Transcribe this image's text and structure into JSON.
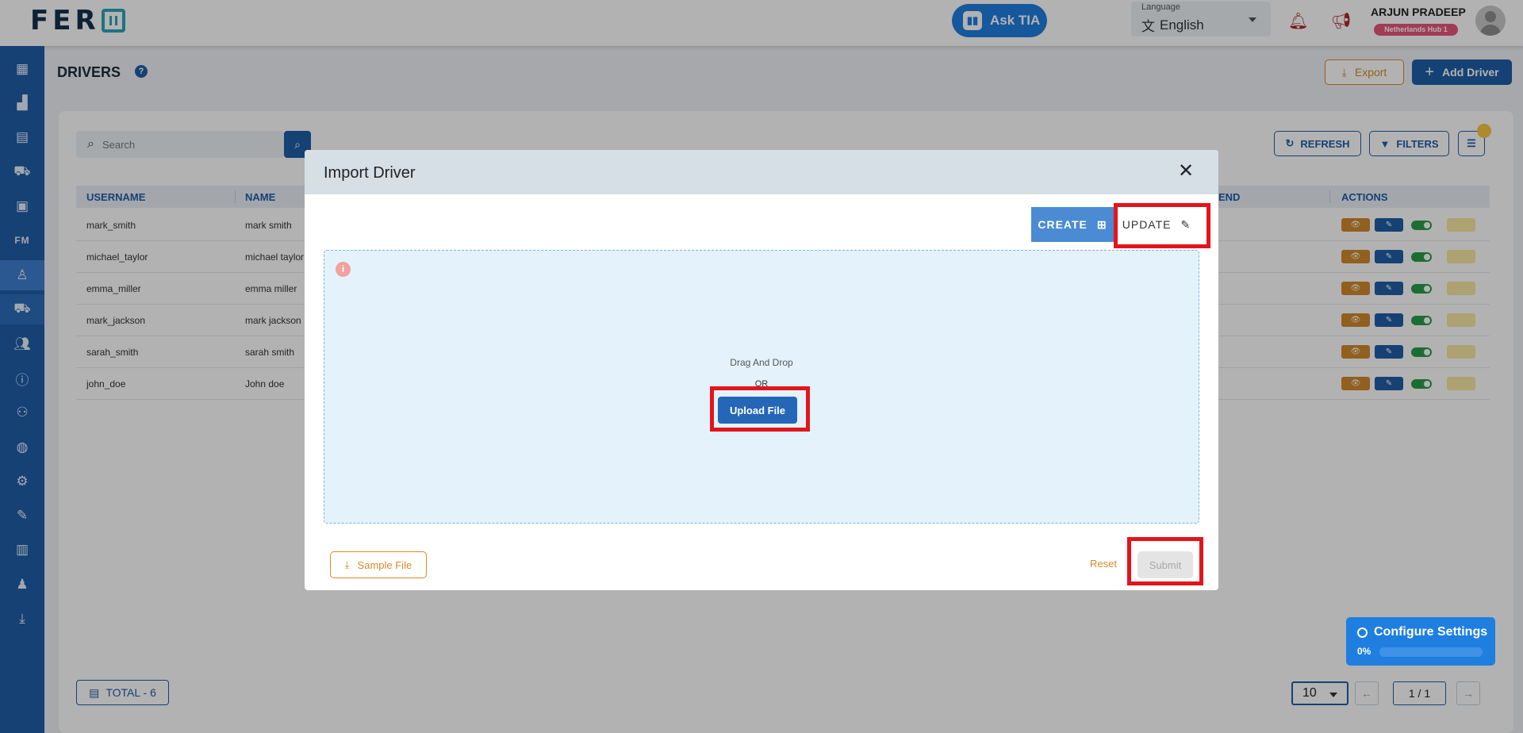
{
  "header": {
    "logo": "FER",
    "ask_tia": "Ask TIA",
    "language_label": "Language",
    "language_value": "English",
    "user_name": "ARJUN PRADEEP",
    "user_hub": "Netherlands Hub 1"
  },
  "sidebar": {
    "fm_label": "FM"
  },
  "page": {
    "title": "DRIVERS",
    "help": "?",
    "export_label": "Export",
    "add_label": "Add Driver",
    "search_placeholder": "Search",
    "refresh_label": "REFRESH",
    "filters_label": "FILTERS"
  },
  "table": {
    "columns": {
      "username": "USERNAME",
      "name": "NAME",
      "partial": "END",
      "actions": "ACTIONS"
    },
    "rows": [
      {
        "username": "mark_smith",
        "name": "mark smith"
      },
      {
        "username": "michael_taylor",
        "name": "michael taylor"
      },
      {
        "username": "emma_miller",
        "name": "emma miller"
      },
      {
        "username": "mark_jackson",
        "name": "mark jackson"
      },
      {
        "username": "sarah_smith",
        "name": "sarah smith"
      },
      {
        "username": "john_doe",
        "name": "John doe"
      }
    ]
  },
  "footer": {
    "total": "TOTAL  - 6",
    "page_size": "10",
    "page_indicator": "1 / 1"
  },
  "config_widget": {
    "title": "Configure Settings",
    "percent": "0%",
    "progress": 0
  },
  "modal": {
    "title": "Import Driver",
    "create_label": "CREATE",
    "update_label": "UPDATE",
    "drag_text": "Drag And Drop",
    "or_text": "OR",
    "upload_label": "Upload File",
    "sample_label": "Sample File",
    "reset_label": "Reset",
    "submit_label": "Submit"
  },
  "colors": {
    "primary": "#1f5ea8",
    "accent": "#d88a2c",
    "highlight": "#e3141c"
  }
}
